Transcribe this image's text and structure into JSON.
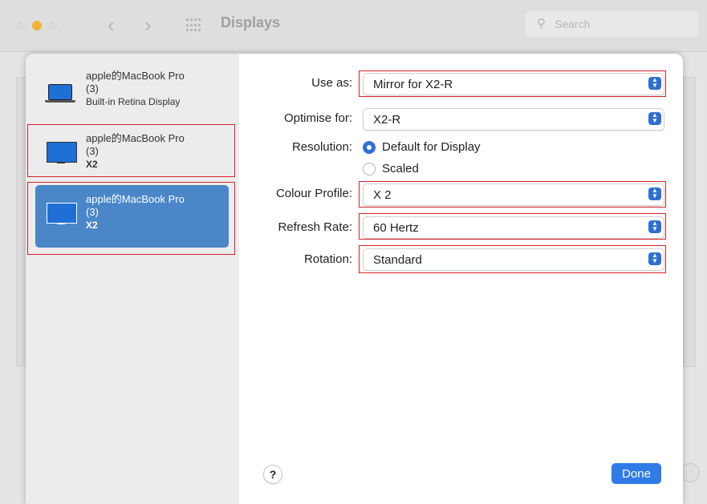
{
  "window": {
    "title": "Displays",
    "search_placeholder": "Search",
    "back_glyph": "‹",
    "forward_glyph": "›"
  },
  "sidebar": {
    "items": [
      {
        "name": "apple的MacBook Pro",
        "index": "(3)",
        "detail": "Built-in Retina Display",
        "icon": "laptop-icon",
        "selected": false
      },
      {
        "name": "apple的MacBook Pro",
        "index": "(3)",
        "detail": "X2",
        "icon": "monitor-icon",
        "selected": false
      },
      {
        "name": "apple的MacBook Pro",
        "index": "(3)",
        "detail": "X2",
        "icon": "monitor-icon",
        "selected": true
      }
    ]
  },
  "form": {
    "use_as": {
      "label": "Use as:",
      "value": "Mirror for X2-R"
    },
    "optimise_for": {
      "label": "Optimise for:",
      "value": "X2-R"
    },
    "resolution": {
      "label": "Resolution:",
      "options": [
        {
          "label": "Default for Display",
          "selected": true
        },
        {
          "label": "Scaled",
          "selected": false
        }
      ]
    },
    "colour_profile": {
      "label": "Colour Profile:",
      "value": "X 2"
    },
    "refresh_rate": {
      "label": "Refresh Rate:",
      "value": "60 Hertz"
    },
    "rotation": {
      "label": "Rotation:",
      "value": "Standard"
    }
  },
  "buttons": {
    "help": "?",
    "done": "Done"
  },
  "colors": {
    "accent": "#2f6fd1",
    "selection": "#4a86c8",
    "highlight": "#d8202a"
  }
}
